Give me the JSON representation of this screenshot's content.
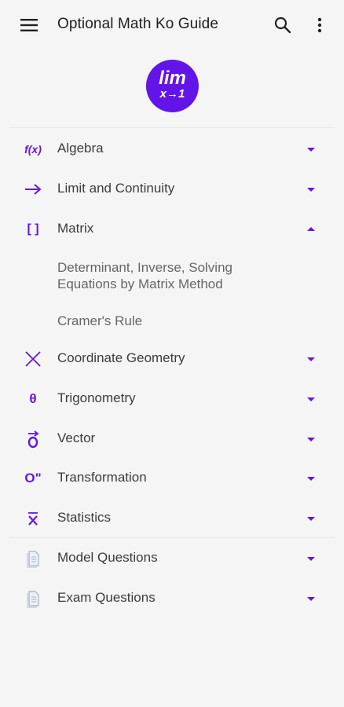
{
  "appbar": {
    "title": "Optional Math Ko Guide",
    "menu_icon": "hamburger-menu-icon",
    "search_icon": "search-icon",
    "more_icon": "more-vert-icon"
  },
  "logo": {
    "line1": "lim",
    "line2": "x→1"
  },
  "colors": {
    "accent": "#6315e8",
    "background": "#f5f5f5",
    "text": "#3c3c3c",
    "subtext": "#666666"
  },
  "topics": [
    {
      "icon_text": "f(x)",
      "icon_name": "function-icon",
      "label": "Algebra",
      "expanded": false
    },
    {
      "icon_text": "→",
      "icon_name": "arrow-right-icon",
      "label": "Limit and Continuity",
      "expanded": false
    },
    {
      "icon_text": "[ ]",
      "icon_name": "brackets-icon",
      "label": "Matrix",
      "expanded": true,
      "subitems": [
        {
          "label": "Determinant, Inverse, Solving Equations by Matrix Method"
        },
        {
          "label": "Cramer's Rule"
        }
      ]
    },
    {
      "icon_text": "╳",
      "icon_name": "cross-axes-icon",
      "label": "Coordinate Geometry",
      "expanded": false
    },
    {
      "icon_text": "θ",
      "icon_name": "theta-icon",
      "label": "Trigonometry",
      "expanded": false
    },
    {
      "icon_text": "O⃗",
      "icon_name": "vector-icon",
      "label": "Vector",
      "expanded": false
    },
    {
      "icon_text": "O\"",
      "icon_name": "transformation-icon",
      "label": "Transformation",
      "expanded": false
    },
    {
      "icon_text": "x̄",
      "icon_name": "mean-icon",
      "label": "Statistics",
      "expanded": false
    }
  ],
  "questions": [
    {
      "icon_name": "document-icon",
      "label": "Model Questions",
      "expanded": false
    },
    {
      "icon_name": "document-icon",
      "label": "Exam Questions",
      "expanded": false
    }
  ]
}
